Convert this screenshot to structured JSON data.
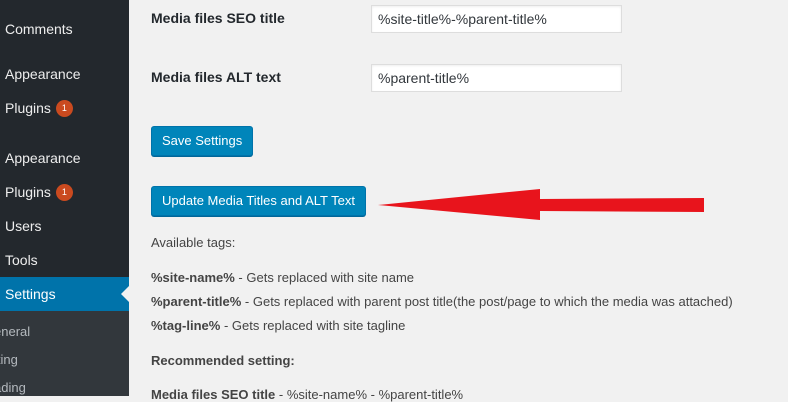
{
  "sidebar": {
    "items": [
      {
        "label": "Comments"
      },
      {
        "label": "Appearance"
      },
      {
        "label": "Plugins",
        "badge": "1"
      },
      {
        "label": "Appearance"
      },
      {
        "label": "Plugins",
        "badge": "1"
      },
      {
        "label": "Users"
      },
      {
        "label": "Tools"
      },
      {
        "label": "Settings"
      }
    ],
    "submenu": [
      "eneral",
      "iting",
      "ading"
    ]
  },
  "form": {
    "seo_title_label": "Media files SEO title",
    "seo_title_value": "%site-title%-%parent-title%",
    "alt_text_label": "Media files ALT text",
    "alt_text_value": "%parent-title%",
    "save_button": "Save Settings",
    "update_button": "Update Media Titles and ALT Text"
  },
  "help": {
    "available_tags_heading": "Available tags:",
    "tags": [
      {
        "tag": "%site-name%",
        "desc": " - Gets replaced with site name"
      },
      {
        "tag": "%parent-title%",
        "desc": " - Gets replaced with parent post title(the post/page to which the media was attached)"
      },
      {
        "tag": "%tag-line%",
        "desc": " - Gets replaced with site tagline"
      }
    ],
    "recommended_heading": "Recommended setting:",
    "recommended_label": "Media files SEO title",
    "recommended_value": " - %site-name% - %parent-title%"
  },
  "annotation": {
    "arrow_color": "#e8141c",
    "icon": "red-arrow-pointing-left"
  },
  "colors": {
    "sidebar_bg": "#23282d",
    "active": "#0073aa",
    "button": "#0085ba",
    "badge": "#ca4a1f"
  }
}
